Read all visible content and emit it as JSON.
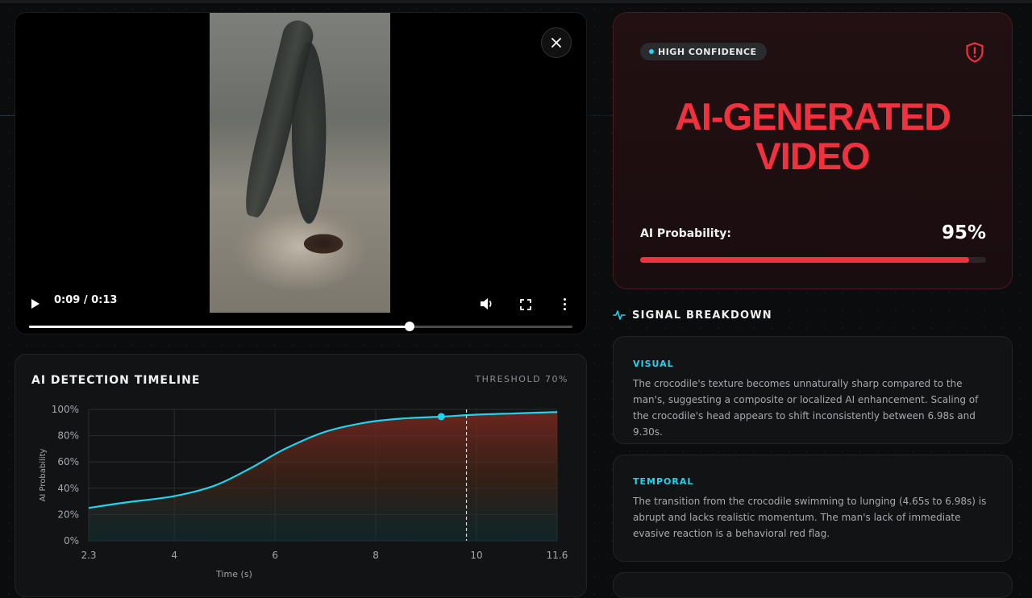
{
  "video": {
    "time": "0:09 / 0:13",
    "progress": 0.7
  },
  "timeline": {
    "title": "AI DETECTION TIMELINE",
    "threshold_label": "THRESHOLD 70%"
  },
  "verdict": {
    "badge": "HIGH CONFIDENCE",
    "title_line1": "AI-GENERATED",
    "title_line2": "VIDEO",
    "prob_label": "AI Probability:",
    "prob_value": "95%",
    "prob_fraction": 0.95,
    "accent": "#f0323f"
  },
  "signals": {
    "title": "SIGNAL BREAKDOWN",
    "items": [
      {
        "label": "VISUAL",
        "text": "The crocodile's texture becomes unnaturally sharp compared to the man's, suggesting a composite or localized AI enhancement. Scaling of the crocodile's head appears to shift inconsistently between 6.98s and 9.30s."
      },
      {
        "label": "TEMPORAL",
        "text": "The transition from the crocodile swimming to lunging (4.65s to 6.98s) is abrupt and lacks realistic momentum. The man's lack of immediate evasive reaction is a behavioral red flag."
      }
    ]
  },
  "chart_data": {
    "type": "line",
    "xlabel": "Time (s)",
    "ylabel": "AI Probability",
    "xlim": [
      2.3,
      11.6
    ],
    "ylim": [
      0,
      100
    ],
    "x_ticks": [
      "2.3",
      "4",
      "6",
      "8",
      "10",
      "11.6"
    ],
    "x_tick_values": [
      2.3,
      4,
      6,
      8,
      10,
      11.6
    ],
    "y_ticks": [
      "0%",
      "20%",
      "40%",
      "60%",
      "80%",
      "100%"
    ],
    "y_tick_values": [
      0,
      20,
      40,
      60,
      80,
      100
    ],
    "series": [
      {
        "x": [
          2.3,
          3.0,
          4.0,
          4.8,
          5.5,
          6.2,
          7.0,
          7.8,
          8.5,
          9.3,
          10.0,
          10.8,
          11.6
        ],
        "y": [
          25,
          29,
          34,
          42,
          55,
          70,
          83,
          90,
          93,
          94.5,
          96,
          97,
          98
        ]
      }
    ],
    "marker": {
      "x": 9.3,
      "y": 94.5
    },
    "current_time": 9.8,
    "line_color": "#22d3ee",
    "grid": true
  }
}
